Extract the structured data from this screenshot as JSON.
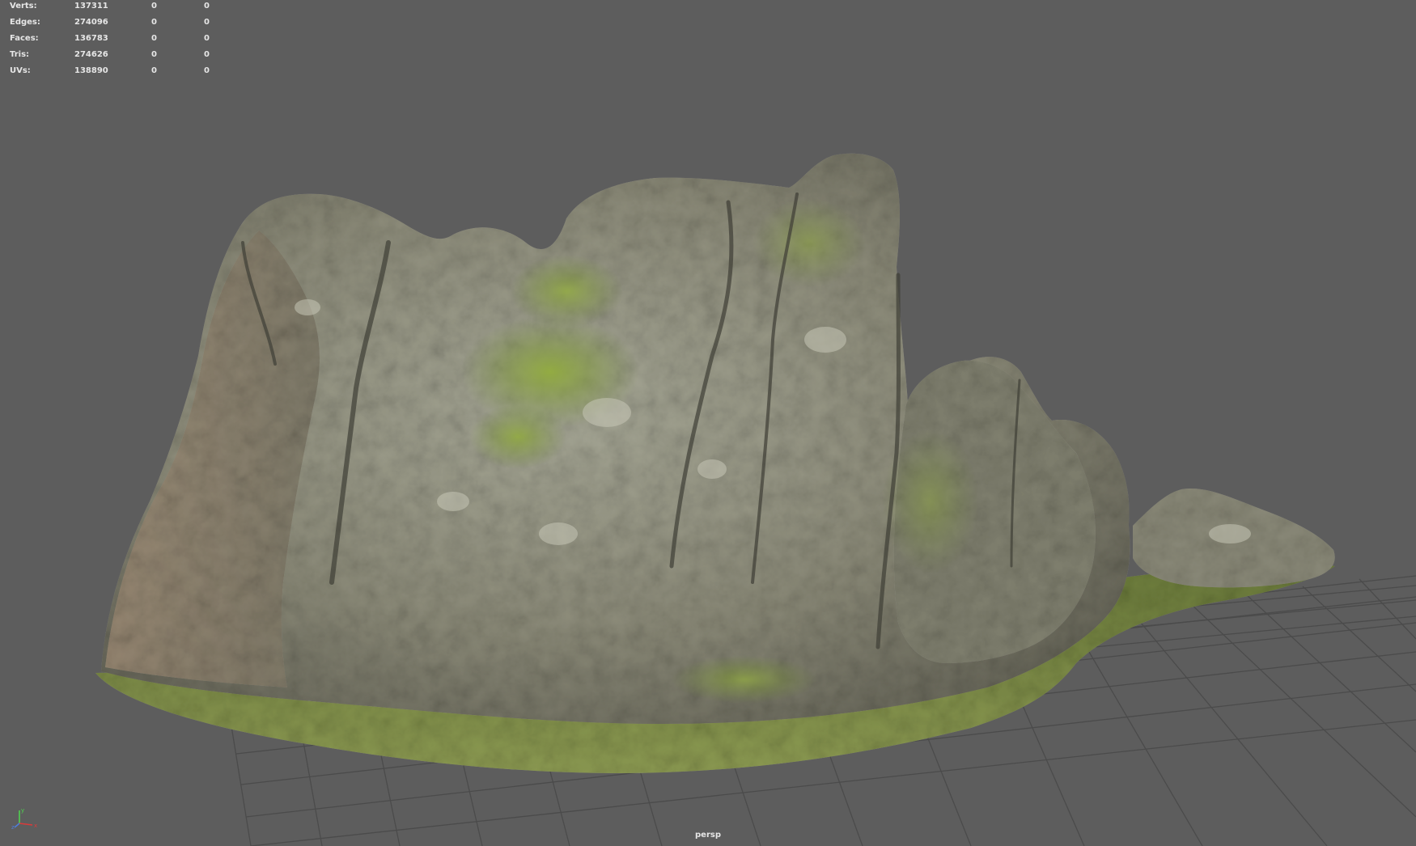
{
  "hud": {
    "rows": [
      {
        "label": "Verts:",
        "total": "137311",
        "selected": "0",
        "component": "0"
      },
      {
        "label": "Edges:",
        "total": "274096",
        "selected": "0",
        "component": "0"
      },
      {
        "label": "Faces:",
        "total": "136783",
        "selected": "0",
        "component": "0"
      },
      {
        "label": "Tris:",
        "total": "274626",
        "selected": "0",
        "component": "0"
      },
      {
        "label": "UVs:",
        "total": "138890",
        "selected": "0",
        "component": "0"
      }
    ]
  },
  "camera": {
    "name": "persp"
  },
  "colors": {
    "background": "#5d5d5d",
    "grid": "#4a4a4a",
    "hud_text": "#e6e6e6",
    "rock_base": "#8a8a78",
    "moss": "#7d9436",
    "grass": "#6e7d3f",
    "axis_x": "#d93b3b",
    "axis_y": "#4fd14f",
    "axis_z": "#4f7bd9"
  },
  "icons": {
    "axis": "view-axis-triad-icon"
  }
}
